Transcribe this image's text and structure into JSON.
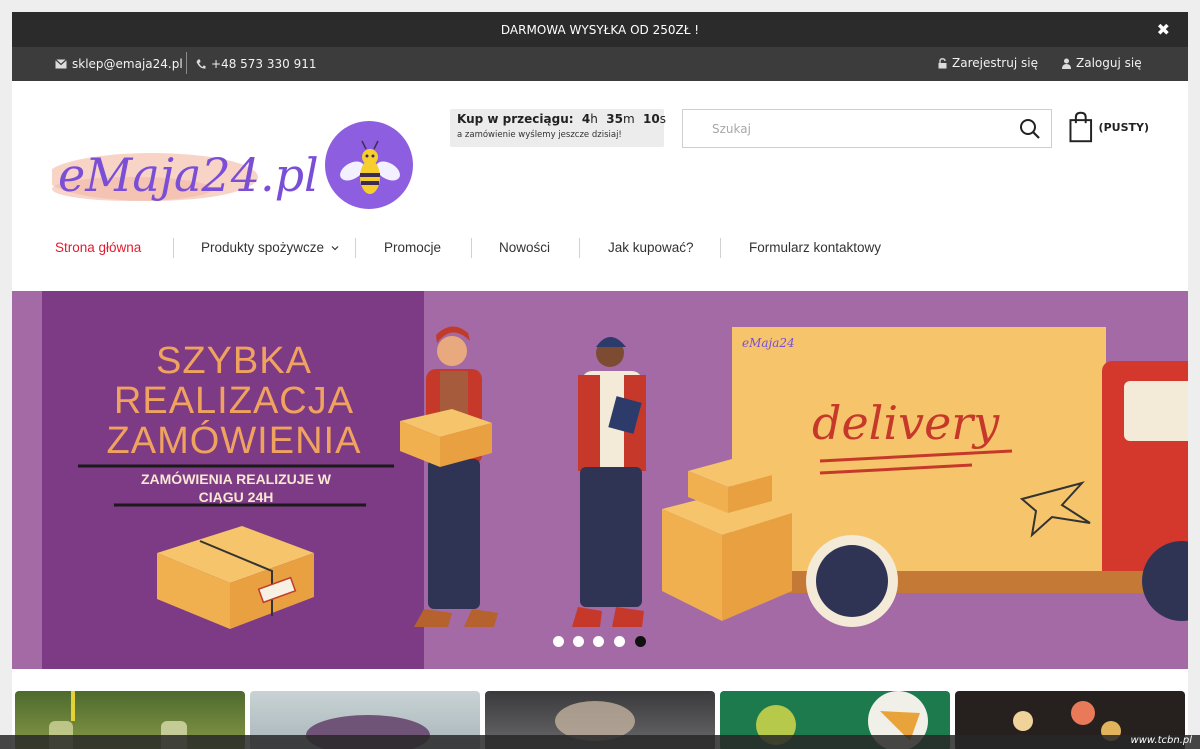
{
  "promo": {
    "text": "DARMOWA WYSYŁKA OD 250ZŁ !",
    "close": "✖"
  },
  "topbar": {
    "email": "sklep@emaja24.pl",
    "phone": "+48 573 330 911",
    "register": "Zarejestruj się",
    "login": "Zaloguj się"
  },
  "logo": {
    "text": "eMaja24.pl"
  },
  "countdown": {
    "label": "Kup w przeciągu:",
    "hours": "4",
    "hours_unit": "h",
    "minutes": "35",
    "minutes_unit": "m",
    "seconds": "10",
    "seconds_unit": "s",
    "note": "a zamówienie wyślemy jeszcze dzisiaj!"
  },
  "search": {
    "placeholder": "Szukaj",
    "value": ""
  },
  "cart": {
    "label": "(PUSTY)"
  },
  "nav": {
    "items": [
      {
        "label": "Strona główna"
      },
      {
        "label": "Produkty spożywcze"
      },
      {
        "label": "Promocje"
      },
      {
        "label": "Nowości"
      },
      {
        "label": "Jak kupować?"
      },
      {
        "label": "Formularz kontaktowy"
      }
    ]
  },
  "banner": {
    "headline_1": "SZYBKA",
    "headline_2": "REALIZACJA",
    "headline_3": "ZAMÓWIENIA",
    "sub_1": "ZAMÓWIENIA REALIZUJE W",
    "sub_2": "CIĄGU 24H",
    "truck_brand": "eMaja24",
    "truck_text": "delivery",
    "slides_total": 5,
    "active_slide": 5
  },
  "watermark": "www.tcbn.pl",
  "colors": {
    "accent_red": "#e31c2d",
    "banner_bg": "#a36aa6",
    "banner_panel": "#7e3b85",
    "headline": "#f0a35e",
    "logo_purple": "#8d5fe0"
  }
}
